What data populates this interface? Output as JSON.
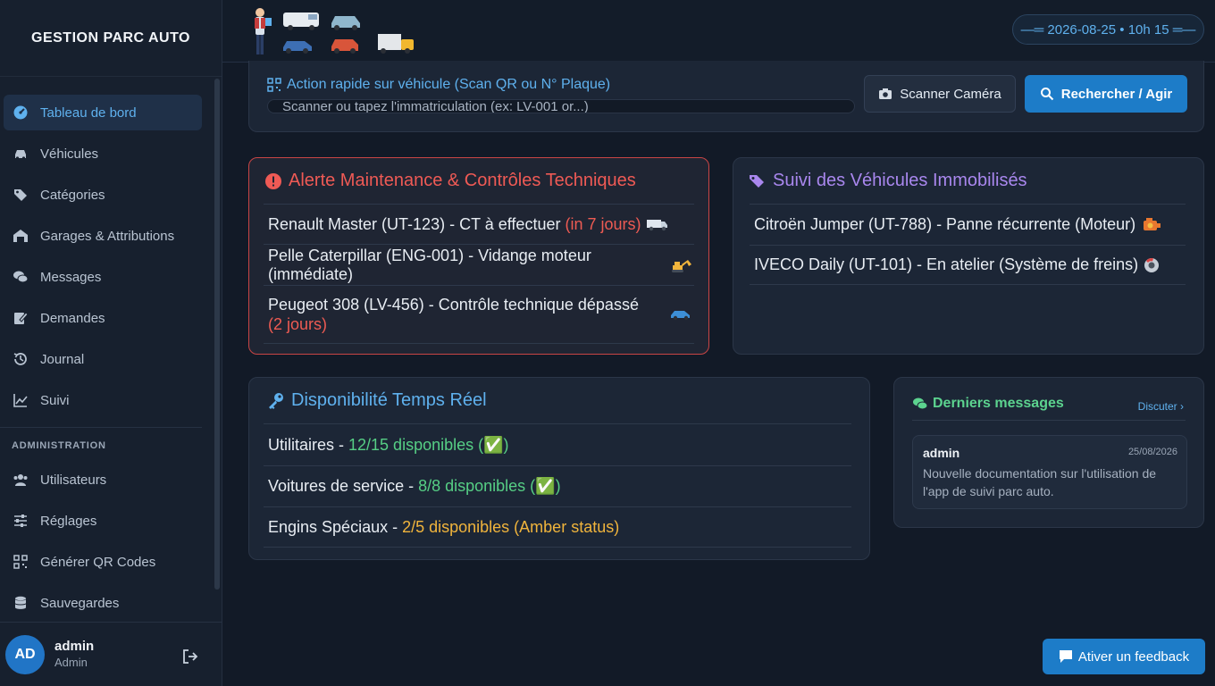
{
  "brand": "GESTION PARC AUTO",
  "nav": {
    "items": [
      {
        "label": "Tableau de bord",
        "icon": "dashboard-icon"
      },
      {
        "label": "Véhicules",
        "icon": "car-icon"
      },
      {
        "label": "Catégories",
        "icon": "tags-icon"
      },
      {
        "label": "Garages & Attributions",
        "icon": "garage-icon"
      },
      {
        "label": "Messages",
        "icon": "comments-icon"
      },
      {
        "label": "Demandes",
        "icon": "edit-icon"
      },
      {
        "label": "Journal",
        "icon": "history-icon"
      },
      {
        "label": "Suivi",
        "icon": "chart-line-icon"
      }
    ],
    "admin_section": "ADMINISTRATION",
    "admin_items": [
      {
        "label": "Utilisateurs",
        "icon": "users-icon"
      },
      {
        "label": "Réglages",
        "icon": "sliders-icon"
      },
      {
        "label": "Générer QR Codes",
        "icon": "qrcode-icon"
      },
      {
        "label": "Sauvegardes",
        "icon": "database-icon"
      }
    ]
  },
  "user": {
    "initials": "AD",
    "name": "admin",
    "role": "Admin"
  },
  "header": {
    "datetime": "—═ 2026-08-25 • 10h 15 ═—"
  },
  "quick_action": {
    "title": "Action rapide sur véhicule (Scan QR ou N° Plaque)",
    "placeholder": "Scanner ou tapez l'immatriculation (ex: LV-001 or...)",
    "scan_button": "Scanner Caméra",
    "search_button": "Rechercher / Agir"
  },
  "maintenance": {
    "title": "Alerte Maintenance & Contrôles Techniques",
    "rows": [
      {
        "text": "Renault Master (UT-123) - CT à effectuer ",
        "highlight": "(in 7 jours)",
        "icon": "van-icon"
      },
      {
        "text": "Pelle Caterpillar (ENG-001) - Vidange moteur (immédiate)",
        "highlight": "",
        "icon": "excavator-icon"
      },
      {
        "text": "Peugeot 308 (LV-456) - Contrôle technique dépassé ",
        "highlight": "(2 jours)",
        "icon": "car-icon"
      }
    ]
  },
  "immobilized": {
    "title": "Suivi des Véhicules Immobilisés",
    "rows": [
      {
        "text": "Citroën Jumper (UT-788) - Panne récurrente (Moteur)",
        "icon": "engine-icon"
      },
      {
        "text": "IVECO Daily (UT-101) - En atelier (Système de freins)",
        "icon": "brake-disc-icon"
      }
    ]
  },
  "availability": {
    "title": "Disponibilité Temps Réel",
    "rows": [
      {
        "label": "Utilitaires - ",
        "status": "12/15 disponibles (✅)",
        "color": "#56cf85"
      },
      {
        "label": "Voitures de service - ",
        "status": "8/8 disponibles (✅)",
        "color": "#56cf85"
      },
      {
        "label": "Engins Spéciaux - ",
        "status": "2/5 disponibles (Amber status)",
        "color": "#f0b43c"
      }
    ]
  },
  "messages": {
    "title": "Derniers messages",
    "link": "Discuter ›",
    "items": [
      {
        "author": "admin",
        "date": "25/08/2026",
        "text": "Nouvelle documentation sur l'utilisation de l'app de suivi parc auto."
      }
    ]
  },
  "feedback_button": "Ativer un feedback",
  "colors": {
    "accent": "#1d7cc8",
    "danger": "#ef5a55",
    "success": "#56cf85",
    "warning": "#f0b43c",
    "purple": "#a987ee"
  }
}
